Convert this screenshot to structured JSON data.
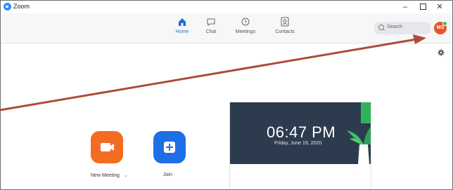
{
  "window": {
    "title": "Zoom",
    "minimize": "–",
    "close": "✕"
  },
  "nav": [
    {
      "label": "Home",
      "icon": "home-icon"
    },
    {
      "label": "Chat",
      "icon": "chat-icon"
    },
    {
      "label": "Meetings",
      "icon": "clock-icon"
    },
    {
      "label": "Contacts",
      "icon": "contacts-icon"
    }
  ],
  "search": {
    "label": "Search"
  },
  "user": {
    "initials": "MS"
  },
  "actions": {
    "new_meeting": "New Meeting",
    "new_meeting_caret": "⌄",
    "join": "Join"
  },
  "card": {
    "time": "06:47 PM",
    "date": "Friday, June 19, 2020"
  },
  "colors": {
    "accent": "#1e6fe6",
    "new_meeting": "#f26d21",
    "card_banner": "#2c3c4e",
    "annotation_arrow": "#b04a3a"
  }
}
